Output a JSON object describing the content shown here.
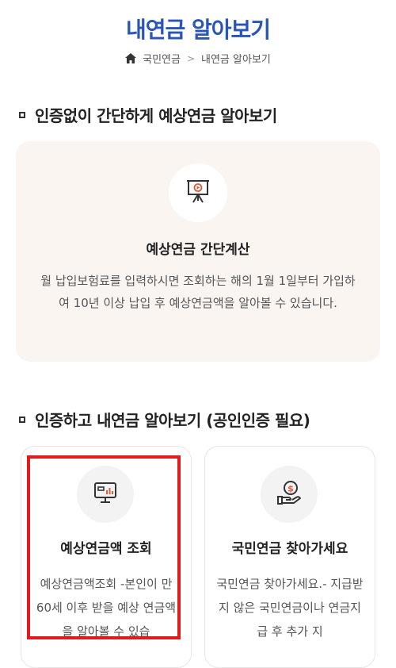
{
  "page": {
    "title": "내연금 알아보기"
  },
  "breadcrumb": {
    "items": [
      "국민연금",
      "내연금 알아보기"
    ]
  },
  "section1": {
    "heading": "인증없이 간단하게 예상연금 알아보기",
    "card": {
      "title": "예상연금 간단계산",
      "description": "월 납입보험료를 입력하시면 조회하는 해의 1월 1일부터 가입하여 10년 이상 납입 후 예상연금액을 알아볼 수 있습니다."
    }
  },
  "section2": {
    "heading": "인증하고 내연금 알아보기 (공인인증 필요)",
    "cards": [
      {
        "title": "예상연금액 조회",
        "description": "예상연금액조회 -본인이 만 60세 이후 받을 예상 연금액을 알아볼 수 있습",
        "icon": "monitor-chart-icon"
      },
      {
        "title": "국민연금 찾아가세요",
        "description": "국민연금 찾아가세요.- 지급받지 않은 국민연금이나 연금지급 후 추가 지",
        "icon": "money-hand-icon"
      }
    ]
  },
  "colors": {
    "title": "#2a55b8",
    "highlight": "#e01b1b",
    "simple_card_bg": "#fbf5f2"
  }
}
